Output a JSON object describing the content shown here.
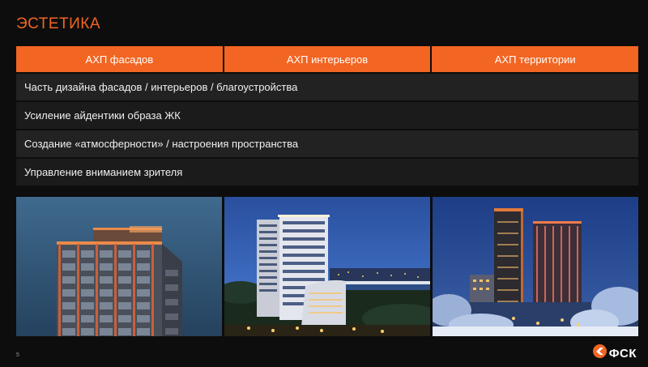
{
  "slide": {
    "title": "ЭСТЕТИКА",
    "page_number": "5"
  },
  "table": {
    "headers": [
      "АХП фасадов",
      "АХП интерьеров",
      "АХП территории"
    ],
    "rows": [
      "Часть дизайна фасадов / интерьеров / благоустройства",
      "Усиление айдентики образа ЖК",
      "Создание «атмосферности» / настроения пространства",
      "Управление вниманием зрителя"
    ]
  },
  "photos": [
    {
      "subject": "building-facade-dusk"
    },
    {
      "subject": "residential-towers-night-river"
    },
    {
      "subject": "twin-towers-winter-night"
    }
  ],
  "logo": {
    "text": "ФСК",
    "icon": "fsk-logo-icon"
  },
  "colors": {
    "accent": "#f26522",
    "background": "#0d0d0d",
    "row": "#222222",
    "row_alt": "#1b1b1b"
  }
}
